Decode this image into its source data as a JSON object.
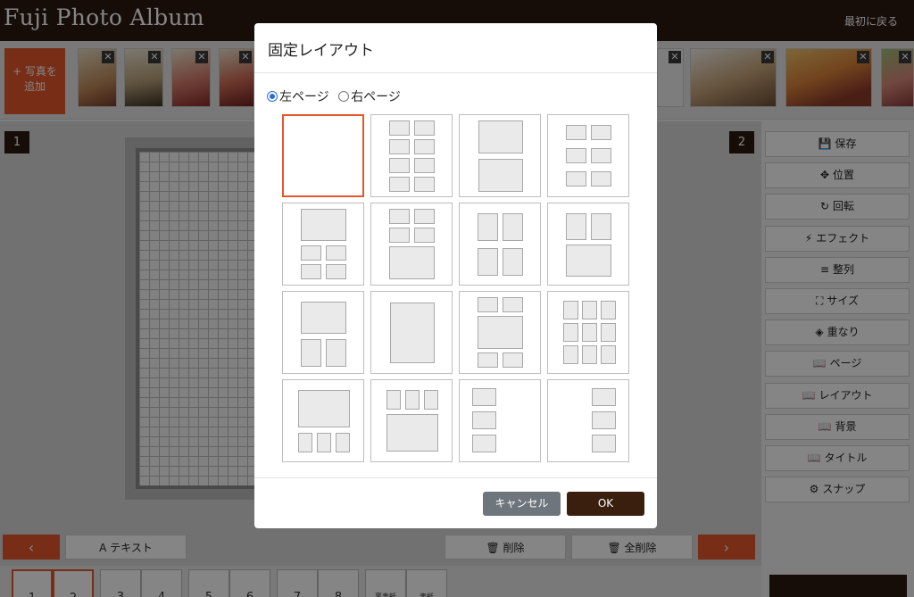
{
  "header": {
    "brand": "Fuji Photo Album",
    "back_link": "最初に戻る"
  },
  "photo_strip": {
    "add_button": {
      "line1": "+ 写真を",
      "line2": "追加"
    },
    "remove_label": "✕"
  },
  "canvas": {
    "left_page_number": "1",
    "right_page_number": "2"
  },
  "toolbar": {
    "items": [
      {
        "icon": "save-icon",
        "glyph": "💾",
        "label": "保存"
      },
      {
        "icon": "move-icon",
        "glyph": "✥",
        "label": "位置"
      },
      {
        "icon": "rotate-icon",
        "glyph": "↻",
        "label": "回転"
      },
      {
        "icon": "bolt-icon",
        "glyph": "⚡",
        "label": "エフェクト"
      },
      {
        "icon": "align-icon",
        "glyph": "≡",
        "label": "整列"
      },
      {
        "icon": "resize-icon",
        "glyph": "⛶",
        "label": "サイズ"
      },
      {
        "icon": "layers-icon",
        "glyph": "◈",
        "label": "重なり"
      },
      {
        "icon": "book-icon",
        "glyph": "📖",
        "label": "ページ"
      },
      {
        "icon": "book-icon",
        "glyph": "📖",
        "label": "レイアウト"
      },
      {
        "icon": "book-icon",
        "glyph": "📖",
        "label": "背景"
      },
      {
        "icon": "book-icon",
        "glyph": "📖",
        "label": "タイトル"
      },
      {
        "icon": "gear-icon",
        "glyph": "⚙",
        "label": "スナップ"
      }
    ]
  },
  "bottom_bar": {
    "prev": "‹",
    "text_button": "A テキスト",
    "delete_button": "🗑 削除",
    "delete_all_button": "🗑 全削除",
    "next": "›"
  },
  "pager": {
    "pages": [
      "1",
      "2",
      "3",
      "4",
      "5",
      "6",
      "7",
      "8"
    ],
    "extra": [
      "裏表紙",
      "表紙"
    ]
  },
  "modal": {
    "title": "固定レイアウト",
    "left_page_option": "左ページ",
    "right_page_option": "右ページ",
    "selected_option": "左ページ",
    "selected_layout": 1,
    "layout_count": 16,
    "cancel_label": "キャンセル",
    "ok_label": "OK"
  },
  "colors": {
    "header_bg": "#2b1a10",
    "accent": "#e4572b",
    "ok_bg": "#3a1e0e",
    "cancel_bg": "#6e757d"
  }
}
